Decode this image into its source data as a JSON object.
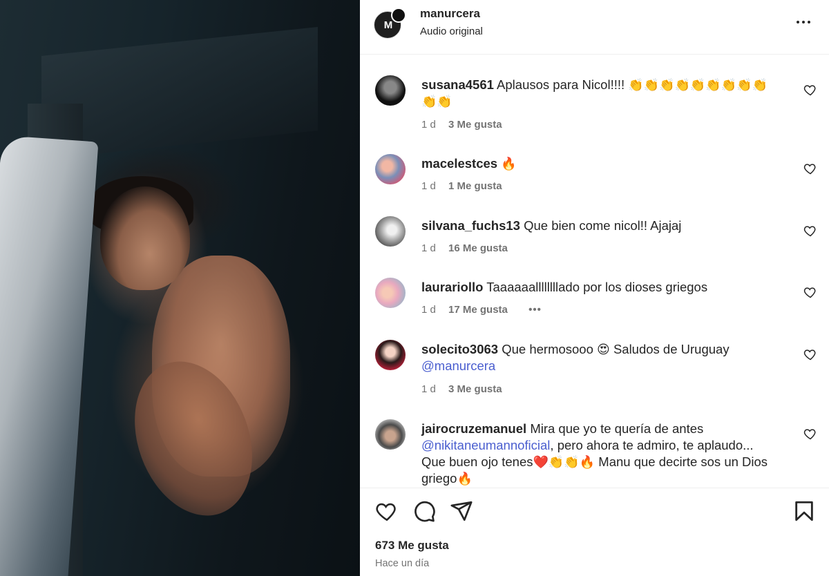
{
  "post": {
    "owner": "manurcera",
    "subtitle": "Audio original",
    "avatar_mark": "M"
  },
  "comments": [
    {
      "user": "susana4561",
      "text": "Aplausos para Nicol!!!!",
      "emoji_line1": "👏👏👏👏👏👏👏👏👏",
      "emoji_line2": "👏👏",
      "time": "1 d",
      "likes": "3 Me gusta"
    },
    {
      "user": "macelestces",
      "text": "",
      "emoji": "🔥",
      "time": "1 d",
      "likes": "1 Me gusta"
    },
    {
      "user": "silvana_fuchs13",
      "text": "Que bien come nicol!! Ajajaj",
      "time": "1 d",
      "likes": "16 Me gusta"
    },
    {
      "user": "laurariollo",
      "text": "Taaaaaallllllllado por los dioses griegos",
      "time": "1 d",
      "likes": "17 Me gusta",
      "more": "•••"
    },
    {
      "user": "solecito3063",
      "text_before": "Que hermosooo",
      "emoji": "😍",
      "text_after": "Saludos de Uruguay",
      "mention": "@manurcera",
      "time": "1 d",
      "likes": "3 Me gusta"
    },
    {
      "user": "jairocruzemanuel",
      "text1": "Mira que yo te quería de antes",
      "mention": "@nikitaneumannoficial",
      "text2": ", pero ahora te admiro, te aplaudo...",
      "text3": "Que buen ojo tenes",
      "emoji_a": "❤️👏👏🔥",
      "text4": "Manu que decirte sos un Dios",
      "text5": "griego",
      "emoji_b": "🔥"
    }
  ],
  "footer": {
    "likes_total": "673 Me gusta",
    "time_ago": "Hace un día"
  },
  "icons": {
    "like": "heart-outline-icon",
    "comment": "comment-bubble-icon",
    "share": "paper-plane-icon",
    "save": "bookmark-icon",
    "more": "more-horizontal-icon"
  }
}
